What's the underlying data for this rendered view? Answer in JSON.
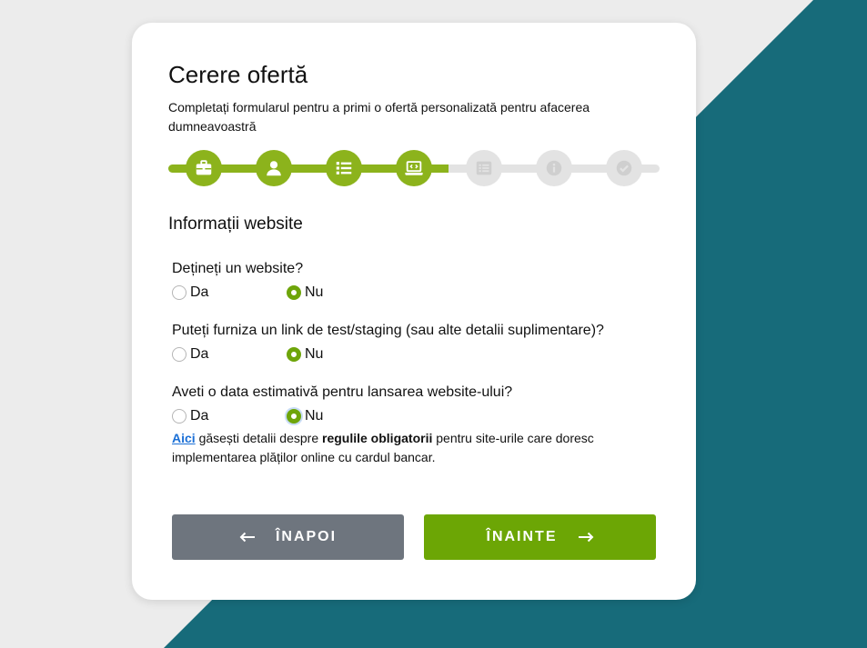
{
  "form": {
    "title": "Cerere ofertă",
    "subtitle": "Completați formularul pentru a primi o ofertă personalizată pentru afacerea dumneavoastră"
  },
  "progress": {
    "completed_fraction": 0.57,
    "steps": [
      {
        "icon": "briefcase-icon",
        "status": "completed"
      },
      {
        "icon": "user-icon",
        "status": "completed"
      },
      {
        "icon": "list-icon",
        "status": "completed"
      },
      {
        "icon": "laptop-code-icon",
        "status": "current"
      },
      {
        "icon": "document-list-icon",
        "status": "pending"
      },
      {
        "icon": "info-icon",
        "status": "pending"
      },
      {
        "icon": "check-circle-icon",
        "status": "pending"
      }
    ]
  },
  "section": {
    "title": "Informații website",
    "questions": [
      {
        "label": "Dețineți un website?",
        "option_yes": "Da",
        "option_no": "Nu",
        "selected": "Nu"
      },
      {
        "label": "Puteți furniza un link de test/staging (sau alte detalii suplimentare)?",
        "option_yes": "Da",
        "option_no": "Nu",
        "selected": "Nu"
      },
      {
        "label": "Aveti o data estimativă pentru lansarea website-ului?",
        "option_yes": "Da",
        "option_no": "Nu",
        "selected": "Nu"
      }
    ],
    "note": {
      "link_text": "Aici",
      "text_before_bold": " găsești detalii despre ",
      "bold_text": "regulile obligatorii",
      "text_after_bold": " pentru site-urile care doresc implementarea plăților online cu cardul bancar."
    }
  },
  "buttons": {
    "back_label": "ÎNAPOI",
    "next_label": "ÎNAINTE"
  },
  "colors": {
    "accent_green": "#8cb31c",
    "button_green": "#6ca605",
    "button_gray": "#6e757e",
    "teal_background": "#176b7a",
    "link_blue": "#1a6fd6"
  }
}
